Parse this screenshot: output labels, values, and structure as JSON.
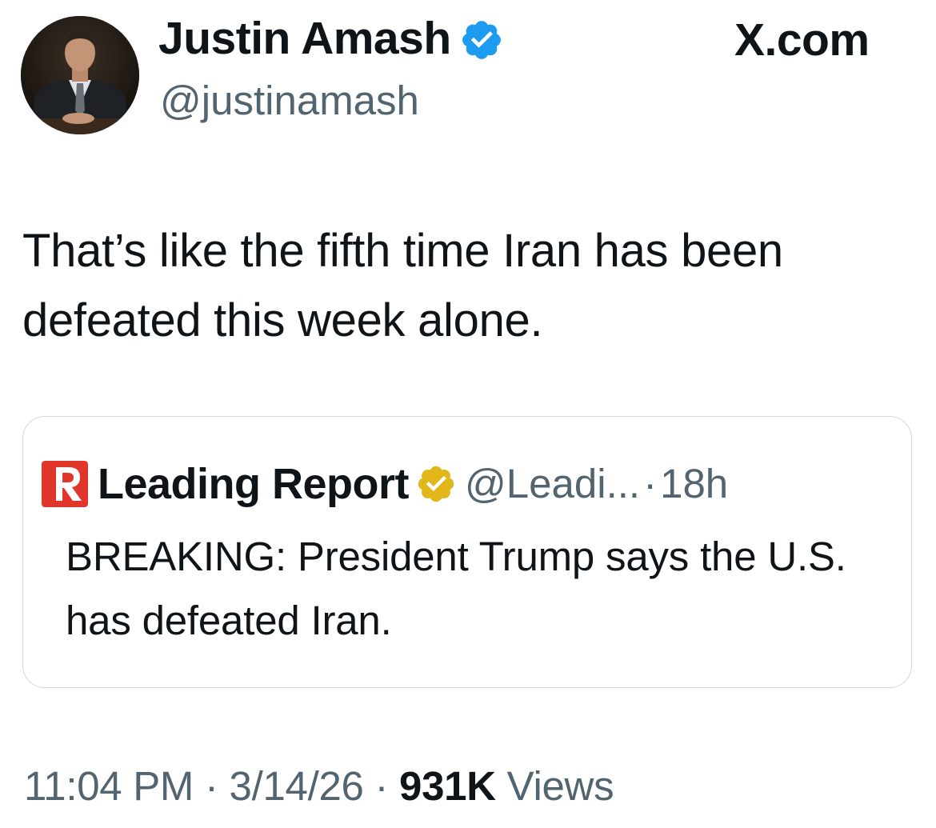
{
  "tweet": {
    "author": {
      "display_name": "Justin Amash",
      "handle": "@justinamash",
      "verified_badge": "verified-blue-icon",
      "badge_color": "#1d9bf0",
      "avatar": "avatar-photo"
    },
    "site_label": "X.com",
    "text": "That’s like the fifth time Iran has been defeated this week alone.",
    "quote": {
      "logo_color": "#e0362c",
      "author_name": "Leading Report",
      "verified_badge": "verified-gold-icon",
      "badge_color": "#e2b719",
      "handle": "@Leadi...",
      "separator": "·",
      "time": "18h",
      "text": "BREAKING: President Trump says the U.S. has defeated Iran."
    },
    "footer": {
      "time": "11:04 PM",
      "date": "3/14/26",
      "separator": "·",
      "views_count": "931K",
      "views_label": "Views"
    }
  }
}
